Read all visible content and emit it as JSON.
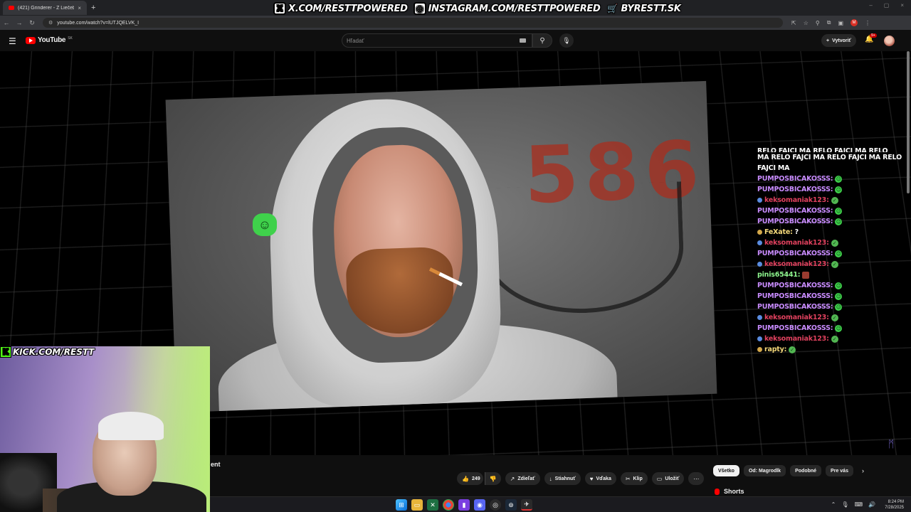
{
  "browser": {
    "tab_title": "(421) Grinderer - Z Liečeb",
    "tab_close": "×",
    "new_tab": "+",
    "window_controls": [
      "–",
      "▢",
      "×"
    ],
    "url": "youtube.com/watch?v=lUTJQELVK_I",
    "nav": [
      "←",
      "→",
      "↻"
    ],
    "tools": [
      "⇱",
      "☆",
      "⚲",
      "⧉",
      "▣"
    ],
    "profile_initial": "M"
  },
  "overlay": {
    "links": [
      {
        "icon": "X",
        "text": "X.COM/RESTTPOWERED"
      },
      {
        "icon": "◎",
        "text": "INSTAGRAM.COM/RESTTPOWERED"
      },
      {
        "icon": "🛒",
        "text": "BYRESTT.SK"
      }
    ],
    "kick": {
      "icon": "K",
      "text": "KICK.COM/RESTT"
    }
  },
  "youtube": {
    "logo_text": "YouTube",
    "country": "SK",
    "search_placeholder": "Hľadať",
    "create_label": "Vytvoriť",
    "notifications": "9+"
  },
  "chat": {
    "spam_partial": "RELO FAJCI MA RELO FAJCI MA RELO FAJCI MA",
    "spam_full": "MA RELO FAJCI MA RELO FAJCI MA RELO FAJCI MA",
    "messages": [
      {
        "user": "PUMPOSBICAKOSSS:",
        "color": "#c98cff",
        "emote": "green",
        "badge": ""
      },
      {
        "user": "PUMPOSBICAKOSSS:",
        "color": "#c98cff",
        "emote": "green",
        "badge": ""
      },
      {
        "user": "keksomaniak123:",
        "color": "#e0415e",
        "emote": "ok",
        "badge": "#5a8ce0"
      },
      {
        "user": "PUMPOSBICAKOSSS:",
        "color": "#c98cff",
        "emote": "green",
        "badge": ""
      },
      {
        "user": "PUMPOSBICAKOSSS:",
        "color": "#c98cff",
        "emote": "green",
        "badge": ""
      },
      {
        "user": "FeXate:",
        "color": "#f5d97a",
        "emote": "text",
        "text": "?",
        "badge": "#d4a84a"
      },
      {
        "user": "keksomaniak123:",
        "color": "#e0415e",
        "emote": "ok",
        "badge": "#5a8ce0"
      },
      {
        "user": "PUMPOSBICAKOSSS:",
        "color": "#c98cff",
        "emote": "green",
        "badge": ""
      },
      {
        "user": "keksomaniak123:",
        "color": "#e0415e",
        "emote": "ok",
        "badge": "#5a8ce0"
      },
      {
        "user": "pinis65441:",
        "color": "#8ef58e",
        "emote": "red",
        "badge": ""
      },
      {
        "user": "PUMPOSBICAKOSSS:",
        "color": "#c98cff",
        "emote": "green",
        "badge": ""
      },
      {
        "user": "PUMPOSBICAKOSSS:",
        "color": "#c98cff",
        "emote": "green",
        "badge": ""
      },
      {
        "user": "PUMPOSBICAKOSSS:",
        "color": "#c98cff",
        "emote": "green",
        "badge": ""
      },
      {
        "user": "keksomaniak123:",
        "color": "#e0415e",
        "emote": "ok",
        "badge": "#5a8ce0"
      },
      {
        "user": "PUMPOSBICAKOSSS:",
        "color": "#c98cff",
        "emote": "green",
        "badge": ""
      },
      {
        "user": "keksomaniak123:",
        "color": "#e0415e",
        "emote": "ok",
        "badge": "#5a8ce0"
      },
      {
        "user": "rapty:",
        "color": "#f5d97a",
        "emote": "ok",
        "badge": "#d4a84a"
      }
    ]
  },
  "video": {
    "graffiti": "586"
  },
  "below_video": {
    "title_fragment": "ent",
    "actions": [
      {
        "icon": "👍",
        "label": "249",
        "kind": "like"
      },
      {
        "icon": "👎",
        "label": "",
        "kind": "dislike"
      },
      {
        "icon": "↗",
        "label": "Zdieľať",
        "kind": "share"
      },
      {
        "icon": "↓",
        "label": "Stiahnuť",
        "kind": "download"
      },
      {
        "icon": "♥",
        "label": "Vďaka",
        "kind": "thanks"
      },
      {
        "icon": "✂",
        "label": "Klip",
        "kind": "clip"
      },
      {
        "icon": "▭",
        "label": "Uložiť",
        "kind": "save"
      },
      {
        "icon": "⋯",
        "label": "",
        "kind": "more"
      }
    ],
    "chips": [
      "Všetko",
      "Od: Magrodlk",
      "Podobné",
      "Pre vás"
    ],
    "chip_next": "›",
    "shorts_label": "Shorts"
  },
  "taskbar": {
    "time": "8:24 PM",
    "date": "7/28/2025",
    "tray": [
      "⌃",
      "🎙",
      "⌨",
      "🔊"
    ]
  }
}
